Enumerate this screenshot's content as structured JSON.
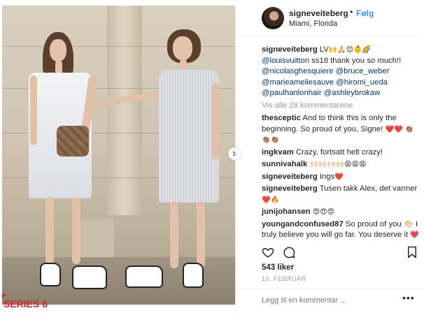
{
  "header": {
    "username": "signeveiteberg",
    "separator": "•",
    "follow_label": "Følg",
    "location": "Miami, Florida"
  },
  "caption": {
    "username": "signeveiteberg",
    "text_before": "LV",
    "emojis": "🙌🙏😊👶🌈",
    "line1_mention": "@louisvuitton",
    "line1_text": " ss18 thank you so much!!",
    "mentions": [
      [
        "@nicolasghesquiere",
        "@bruce_weber"
      ],
      [
        "@marieameliesauve",
        "@hiromi_ueda"
      ],
      [
        "@paulhanlonhair",
        "@ashleybrokaw"
      ]
    ]
  },
  "view_all_label": "Vis alle 28 kommentarene",
  "comments": [
    {
      "user": "thesceptic",
      "text": "And to think this is only the beginning. So proud of you, Signe!",
      "emojis": " ❤️❤️ 👏🏽👏🏽👏🏽"
    },
    {
      "user": "ingkvam",
      "text": "Crazy, fortsatt helt crazy!",
      "emojis": ""
    },
    {
      "user": "sunnivahalk",
      "text": "",
      "emojis": "🙌🏻🙌🏻🙌🏻🙌🏻😩😩😩"
    },
    {
      "user": "signeveiteberg",
      "text": "Ings",
      "emojis": "❤️"
    },
    {
      "user": "signeveiteberg",
      "text": "Tusen takk Alex, det varmer",
      "emojis": "❤️🔥"
    },
    {
      "user": "junijohansen",
      "text": "",
      "emojis": "😍😍😍"
    },
    {
      "user": "youngandconfused87",
      "text": "So proud of you 👏🏻 I truly believe you will go far. You deserve it",
      "emojis": " ❤️"
    }
  ],
  "likes_label": "543 liker",
  "date_label": "10. FEBRUAR",
  "add_comment_placeholder": "Legg til en kommentar ...",
  "more_label": "•••",
  "badge": {
    "label": "SERIES 8"
  },
  "icons": {
    "like": "heart-outline-icon",
    "comment": "speech-bubble-icon",
    "save": "bookmark-outline-icon",
    "carousel": "chevron-right-icon"
  },
  "colors": {
    "link_blue": "#3897f0",
    "mention_blue": "#003569",
    "muted": "#999999",
    "badge_red": "#e0202a"
  }
}
